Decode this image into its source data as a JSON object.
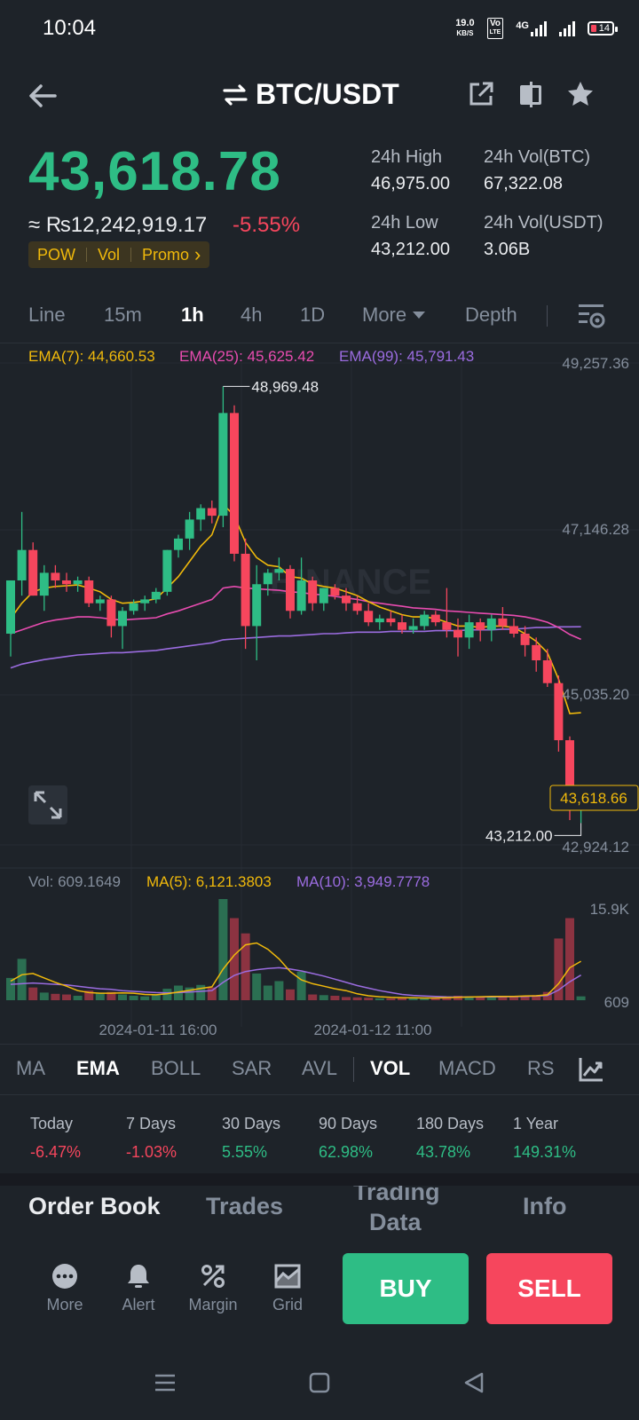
{
  "status_bar": {
    "time": "10:04",
    "net_speed_value": "19.0",
    "net_speed_unit": "KB/S",
    "volte_top": "Vo",
    "volte_bottom": "LTE",
    "network": "4G",
    "battery": "14"
  },
  "header": {
    "pair": "BTC/USDT",
    "icons": [
      "back-arrow-icon",
      "swap-icon",
      "share-icon",
      "compare-icon",
      "star-icon"
    ]
  },
  "ticker": {
    "last_price": "43,618.78",
    "fiat_price": "≈ ₨12,242,919.17",
    "change_pct": "-5.55%",
    "tags": [
      "POW",
      "Vol",
      "Promo"
    ],
    "tag_more": "›",
    "high_label": "24h High",
    "high_value": "46,975.00",
    "low_label": "24h Low",
    "low_value": "43,212.00",
    "vol_btc_label": "24h Vol(BTC)",
    "vol_btc_value": "67,322.08",
    "vol_usdt_label": "24h Vol(USDT)",
    "vol_usdt_value": "3.06B"
  },
  "timeframes": {
    "items": [
      "Line",
      "15m",
      "1h",
      "4h",
      "1D",
      "More"
    ],
    "active": "1h",
    "depth": "Depth"
  },
  "chart": {
    "ema7": "EMA(7): 44,660.53",
    "ema25": "EMA(25): 45,625.42",
    "ema99": "EMA(99): 45,791.43",
    "price_axis": [
      "49,257.36",
      "47,146.28",
      "45,035.20",
      "42,924.12"
    ],
    "high_marker": "48,969.48",
    "low_marker": "43,212.00",
    "current_tag": "43,618.66",
    "watermark": "BINANCE",
    "vol_label": "Vol: 609.1649",
    "vol_ma5": "MA(5): 6,121.3803",
    "vol_ma10": "MA(10): 3,949.7778",
    "vol_axis": [
      "15.9K",
      "609"
    ],
    "time_labels": [
      "2024-01-11 16:00",
      "2024-01-12 11:00"
    ],
    "colors": {
      "up": "#2ebd85",
      "down": "#f6465d",
      "ema7": "#f0b90b",
      "ema25": "#e84cb0",
      "ema99": "#9b6ce0"
    }
  },
  "chart_data": {
    "type": "candlestick",
    "pair": "BTC/USDT",
    "interval": "1h",
    "ylim": [
      42924.12,
      49257.36
    ],
    "candles": [
      {
        "o": 45700,
        "h": 46000,
        "l": 45400,
        "c": 46400
      },
      {
        "o": 46400,
        "h": 47300,
        "l": 46200,
        "c": 46800
      },
      {
        "o": 46800,
        "h": 46900,
        "l": 46200,
        "c": 46200
      },
      {
        "o": 46200,
        "h": 46600,
        "l": 46000,
        "c": 46500
      },
      {
        "o": 46500,
        "h": 46600,
        "l": 46300,
        "c": 46400
      },
      {
        "o": 46400,
        "h": 46500,
        "l": 46250,
        "c": 46350
      },
      {
        "o": 46350,
        "h": 46450,
        "l": 46250,
        "c": 46400
      },
      {
        "o": 46400,
        "h": 46450,
        "l": 46050,
        "c": 46100
      },
      {
        "o": 46100,
        "h": 46200,
        "l": 46000,
        "c": 46150
      },
      {
        "o": 46150,
        "h": 46200,
        "l": 45650,
        "c": 45800
      },
      {
        "o": 45800,
        "h": 46050,
        "l": 45500,
        "c": 46000
      },
      {
        "o": 46000,
        "h": 46150,
        "l": 45950,
        "c": 46100
      },
      {
        "o": 46100,
        "h": 46200,
        "l": 46000,
        "c": 46150
      },
      {
        "o": 46150,
        "h": 46300,
        "l": 46100,
        "c": 46250
      },
      {
        "o": 46250,
        "h": 46800,
        "l": 46200,
        "c": 46800
      },
      {
        "o": 46800,
        "h": 47000,
        "l": 46700,
        "c": 46950
      },
      {
        "o": 46950,
        "h": 47300,
        "l": 46800,
        "c": 47200
      },
      {
        "o": 47200,
        "h": 47400,
        "l": 47050,
        "c": 47350
      },
      {
        "o": 47350,
        "h": 47450,
        "l": 47150,
        "c": 47250
      },
      {
        "o": 47250,
        "h": 48950,
        "l": 47100,
        "c": 48600
      },
      {
        "o": 48600,
        "h": 48700,
        "l": 46650,
        "c": 46750
      },
      {
        "o": 46750,
        "h": 46950,
        "l": 45500,
        "c": 45800
      },
      {
        "o": 45800,
        "h": 46600,
        "l": 45350,
        "c": 46350
      },
      {
        "o": 46350,
        "h": 46550,
        "l": 46200,
        "c": 46500
      },
      {
        "o": 46500,
        "h": 46700,
        "l": 46400,
        "c": 46550
      },
      {
        "o": 46550,
        "h": 46600,
        "l": 45900,
        "c": 46000
      },
      {
        "o": 46000,
        "h": 46700,
        "l": 45950,
        "c": 46400
      },
      {
        "o": 46400,
        "h": 46450,
        "l": 46000,
        "c": 46100
      },
      {
        "o": 46100,
        "h": 46300,
        "l": 46000,
        "c": 46300
      },
      {
        "o": 46300,
        "h": 46350,
        "l": 46150,
        "c": 46200
      },
      {
        "o": 46200,
        "h": 46300,
        "l": 46000,
        "c": 46100
      },
      {
        "o": 46100,
        "h": 46200,
        "l": 45950,
        "c": 46000
      },
      {
        "o": 46000,
        "h": 46100,
        "l": 45800,
        "c": 45850
      },
      {
        "o": 45850,
        "h": 45950,
        "l": 45750,
        "c": 45900
      },
      {
        "o": 45900,
        "h": 46000,
        "l": 45800,
        "c": 45850
      },
      {
        "o": 45850,
        "h": 45950,
        "l": 45700,
        "c": 45750
      },
      {
        "o": 45750,
        "h": 45900,
        "l": 45700,
        "c": 45800
      },
      {
        "o": 45800,
        "h": 46000,
        "l": 45750,
        "c": 45950
      },
      {
        "o": 45950,
        "h": 46000,
        "l": 45800,
        "c": 45850
      },
      {
        "o": 45850,
        "h": 46300,
        "l": 45650,
        "c": 45750
      },
      {
        "o": 45750,
        "h": 45900,
        "l": 45400,
        "c": 45650
      },
      {
        "o": 45650,
        "h": 45950,
        "l": 45500,
        "c": 45850
      },
      {
        "o": 45850,
        "h": 45900,
        "l": 45600,
        "c": 45750
      },
      {
        "o": 45750,
        "h": 45950,
        "l": 45600,
        "c": 45900
      },
      {
        "o": 45900,
        "h": 46050,
        "l": 45750,
        "c": 45800
      },
      {
        "o": 45800,
        "h": 45900,
        "l": 45650,
        "c": 45700
      },
      {
        "o": 45700,
        "h": 45800,
        "l": 45400,
        "c": 45550
      },
      {
        "o": 45550,
        "h": 45650,
        "l": 45200,
        "c": 45350
      },
      {
        "o": 45350,
        "h": 45500,
        "l": 45000,
        "c": 45050
      },
      {
        "o": 45050,
        "h": 45150,
        "l": 44150,
        "c": 44300
      },
      {
        "o": 44300,
        "h": 44350,
        "l": 43250,
        "c": 43450
      },
      {
        "o": 43450,
        "h": 43500,
        "l": 43212,
        "c": 43618.66
      }
    ],
    "ema7": [
      45900,
      46100,
      46250,
      46300,
      46320,
      46330,
      46340,
      46300,
      46250,
      46150,
      46100,
      46110,
      46130,
      46160,
      46300,
      46450,
      46650,
      46850,
      47000,
      47400,
      47250,
      46900,
      46700,
      46600,
      46580,
      46450,
      46430,
      46350,
      46320,
      46300,
      46250,
      46200,
      46120,
      46050,
      46000,
      45950,
      45920,
      45920,
      45900,
      45850,
      45800,
      45800,
      45780,
      45800,
      45800,
      45780,
      45700,
      45600,
      45450,
      45100,
      44650,
      44660.53
    ],
    "ema25": [
      45700,
      45750,
      45800,
      45850,
      45880,
      45900,
      45920,
      45920,
      45910,
      45890,
      45880,
      45890,
      45900,
      45910,
      45960,
      46000,
      46050,
      46100,
      46150,
      46300,
      46320,
      46300,
      46290,
      46280,
      46270,
      46250,
      46240,
      46220,
      46210,
      46190,
      46170,
      46150,
      46120,
      46100,
      46080,
      46060,
      46040,
      46030,
      46020,
      46000,
      45990,
      45980,
      45970,
      45960,
      45950,
      45940,
      45920,
      45890,
      45850,
      45780,
      45690,
      45625.42
    ],
    "ema99": [
      45250,
      45300,
      45330,
      45360,
      45380,
      45400,
      45420,
      45430,
      45440,
      45450,
      45450,
      45460,
      45470,
      45480,
      45500,
      45520,
      45540,
      45560,
      45580,
      45620,
      45630,
      45640,
      45650,
      45660,
      45670,
      45670,
      45680,
      45690,
      45700,
      45700,
      45710,
      45720,
      45720,
      45720,
      45730,
      45730,
      45730,
      45730,
      45740,
      45740,
      45740,
      45750,
      45750,
      45750,
      45760,
      45760,
      45770,
      45780,
      45780,
      45790,
      45790,
      45791.43
    ],
    "volume": [
      3500,
      6500,
      2000,
      1200,
      1000,
      900,
      700,
      1500,
      1100,
      1300,
      900,
      700,
      600,
      800,
      1800,
      2300,
      2000,
      2400,
      2000,
      15900,
      12900,
      10500,
      4200,
      2300,
      3000,
      1700,
      4500,
      900,
      800,
      700,
      500,
      450,
      400,
      300,
      300,
      400,
      350,
      300,
      300,
      600,
      700,
      600,
      500,
      600,
      700,
      500,
      700,
      800,
      1300,
      9700,
      12900,
      609
    ],
    "vol_ma5": [
      3000,
      4000,
      4200,
      3500,
      2800,
      2200,
      1500,
      1200,
      1100,
      1100,
      1150,
      1100,
      900,
      850,
      1000,
      1300,
      1550,
      1850,
      2100,
      4900,
      7100,
      8700,
      9000,
      8000,
      6500,
      4500,
      3200,
      2600,
      2200,
      1800,
      1500,
      1000,
      700,
      550,
      450,
      400,
      380,
      350,
      350,
      400,
      450,
      500,
      550,
      600,
      600,
      600,
      650,
      700,
      850,
      2600,
      5100,
      6121.3803
    ],
    "vol_ma10": [
      2500,
      2600,
      2700,
      2600,
      2500,
      2400,
      2200,
      2000,
      1800,
      1700,
      1500,
      1400,
      1300,
      1200,
      1150,
      1200,
      1300,
      1400,
      1500,
      2800,
      3900,
      4500,
      4800,
      5000,
      5100,
      4900,
      4600,
      4200,
      3800,
      3300,
      2800,
      2300,
      1900,
      1500,
      1200,
      900,
      750,
      650,
      580,
      520,
      500,
      500,
      500,
      520,
      540,
      560,
      600,
      650,
      720,
      1600,
      2900,
      3949.7778
    ],
    "xlabels": [
      "2024-01-11 16:00",
      "2024-01-12 11:00"
    ]
  },
  "indicator_tabs": {
    "items": [
      "MA",
      "EMA",
      "BOLL",
      "SAR",
      "AVL",
      "VOL",
      "MACD",
      "RSI"
    ],
    "active": [
      "EMA",
      "VOL"
    ]
  },
  "performance": [
    {
      "label": "Today",
      "value": "-6.47%",
      "dir": "down"
    },
    {
      "label": "7 Days",
      "value": "-1.03%",
      "dir": "down"
    },
    {
      "label": "30 Days",
      "value": "5.55%",
      "dir": "up"
    },
    {
      "label": "90 Days",
      "value": "62.98%",
      "dir": "up"
    },
    {
      "label": "180 Days",
      "value": "43.78%",
      "dir": "up"
    },
    {
      "label": "1 Year",
      "value": "149.31%",
      "dir": "up"
    }
  ],
  "bottom_tabs": {
    "order_book": "Order Book",
    "trades": "Trades",
    "trading_data_1": "Trading",
    "trading_data_2": "Data",
    "info": "Info"
  },
  "actions": {
    "more": "More",
    "alert": "Alert",
    "margin": "Margin",
    "grid": "Grid",
    "buy": "BUY",
    "sell": "SELL"
  }
}
